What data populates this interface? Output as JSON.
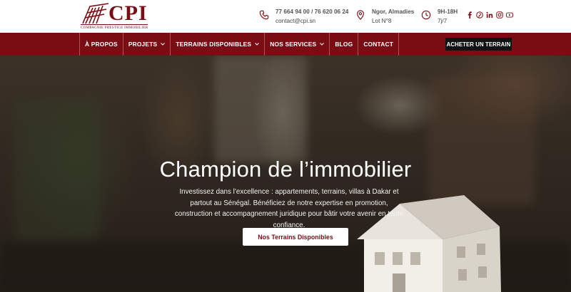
{
  "brand": {
    "name": "CPI",
    "tagline": "COMPAGNIE PRESTIGE IMMOBILIER",
    "color": "#7a0d14"
  },
  "contact": {
    "phones": "77 664 94 00 / 76 620 06 24",
    "email": "contact@cpi.sn",
    "address_line1": "Ngor, Almadies",
    "address_line2": "Lot N°8",
    "hours_line1": "9H-18H",
    "hours_line2": "7j/7"
  },
  "socials": [
    "facebook-icon",
    "pinterest-icon",
    "linkedin-icon",
    "instagram-icon",
    "youtube-icon"
  ],
  "nav": {
    "items": [
      {
        "label": "À PROPOS",
        "dropdown": false
      },
      {
        "label": "PROJETS",
        "dropdown": true
      },
      {
        "label": "TERRAINS DISPONIBLES",
        "dropdown": true
      },
      {
        "label": "NOS SERVICES",
        "dropdown": true
      },
      {
        "label": "BLOG",
        "dropdown": false
      },
      {
        "label": "CONTACT",
        "dropdown": false
      }
    ],
    "cta": "ACHETER UN TERRAIN"
  },
  "hero": {
    "title": "Champion de l’immobilier",
    "subtitle": "Investissez dans l’excellence : appartements, terrains, villas à Dakar et partout au Sénégal. Bénéficiez de notre expertise en promotion, construction et accompagnement juridique pour bâtir votre avenir en toute confiance.",
    "button": "Nos Terrains Disponibles"
  }
}
